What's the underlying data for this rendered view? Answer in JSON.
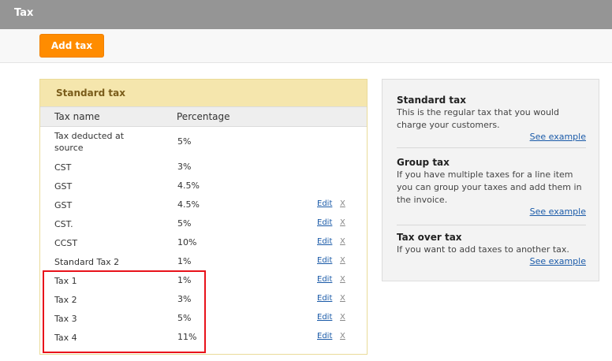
{
  "header": {
    "title": "Tax"
  },
  "toolbar": {
    "add_label": "Add tax"
  },
  "standard_panel": {
    "title": "Standard tax",
    "columns": {
      "name": "Tax name",
      "percentage": "Percentage"
    },
    "rows": [
      {
        "name": "Tax deducted at source",
        "percentage": "5%",
        "edit": "",
        "delete": ""
      },
      {
        "name": "CST",
        "percentage": "3%",
        "edit": "",
        "delete": ""
      },
      {
        "name": "GST",
        "percentage": "4.5%",
        "edit": "",
        "delete": ""
      },
      {
        "name": "GST",
        "percentage": "4.5%",
        "edit": "Edit",
        "delete": "X"
      },
      {
        "name": "CST.",
        "percentage": "5%",
        "edit": "Edit",
        "delete": "X"
      },
      {
        "name": "CCST",
        "percentage": "10%",
        "edit": "Edit",
        "delete": "X"
      },
      {
        "name": "Standard Tax 2",
        "percentage": "1%",
        "edit": "Edit",
        "delete": "X"
      },
      {
        "name": "Tax 1",
        "percentage": "1%",
        "edit": "Edit",
        "delete": "X"
      },
      {
        "name": "Tax 2",
        "percentage": "3%",
        "edit": "Edit",
        "delete": "X"
      },
      {
        "name": "Tax 3",
        "percentage": "5%",
        "edit": "Edit",
        "delete": "X"
      },
      {
        "name": "Tax 4",
        "percentage": "11%",
        "edit": "Edit",
        "delete": "X"
      }
    ]
  },
  "info_panel": {
    "blocks": [
      {
        "title": "Standard tax",
        "description": "This is the regular tax that you would charge your customers.",
        "link": "See example"
      },
      {
        "title": "Group tax",
        "description": "If you have multiple taxes for a line item you can group your taxes and add them in the invoice.",
        "link": "See example"
      },
      {
        "title": "Tax over tax",
        "description": "If you want to add taxes to another tax.",
        "link": "See example"
      }
    ]
  },
  "colors": {
    "accent": "#ff8c00",
    "header_bar": "#959595",
    "panel_header": "#f5e6ad",
    "highlight": "#e8121a",
    "link": "#1a5aa8"
  }
}
